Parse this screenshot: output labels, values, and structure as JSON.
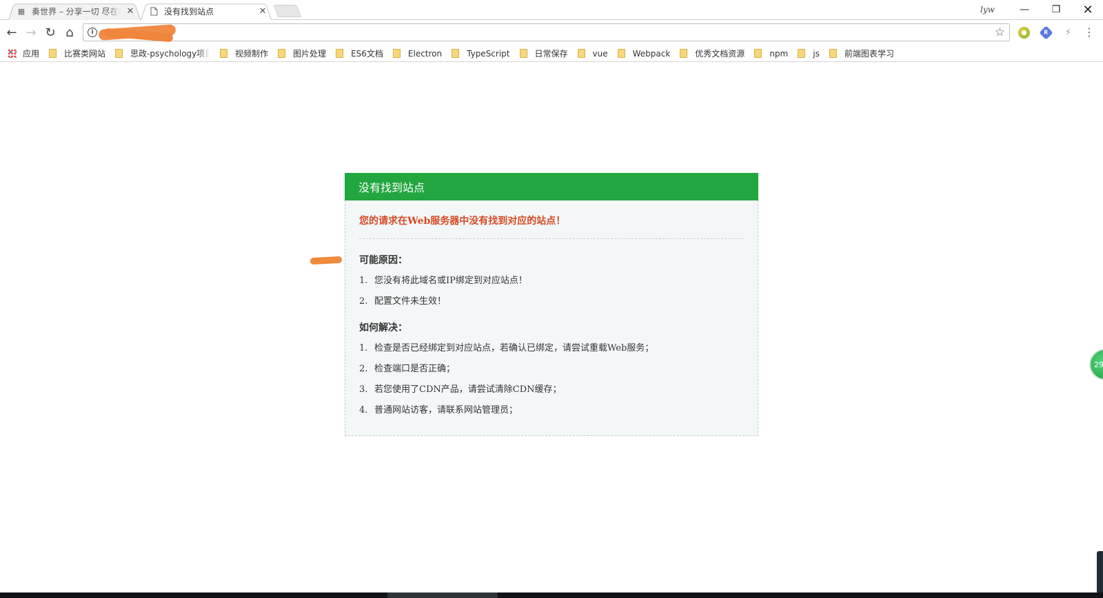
{
  "browser": {
    "tabs": [
      {
        "title": "奏世界 – 分享一切 尽在奏世界",
        "favicon": "site-favicon",
        "active": false
      },
      {
        "title": "没有找到站点",
        "favicon": "page-icon",
        "active": true
      }
    ],
    "profile_name": "lyw",
    "window_controls": {
      "minimize": "—",
      "maximize": "❐",
      "close": "✕"
    },
    "nav": {
      "back": "←",
      "forward": "→",
      "reload": "↻",
      "home": "⌂"
    },
    "address_bar": {
      "url": "",
      "url_redacted": true
    },
    "menu_glyph": "⋮"
  },
  "bookmarks": [
    {
      "label": "应用",
      "type": "apps"
    },
    {
      "label": "比赛类网站",
      "type": "folder"
    },
    {
      "label": "思政-psychology项目",
      "type": "folder"
    },
    {
      "label": "视频制作",
      "type": "folder"
    },
    {
      "label": "图片处理",
      "type": "folder"
    },
    {
      "label": "ES6文档",
      "type": "folder"
    },
    {
      "label": "Electron",
      "type": "folder"
    },
    {
      "label": "TypeScript",
      "type": "folder"
    },
    {
      "label": "日常保存",
      "type": "folder"
    },
    {
      "label": "vue",
      "type": "folder"
    },
    {
      "label": "Webpack",
      "type": "folder"
    },
    {
      "label": "优秀文档资源",
      "type": "folder"
    },
    {
      "label": "npm",
      "type": "folder"
    },
    {
      "label": "js",
      "type": "folder"
    },
    {
      "label": "前端图表学习",
      "type": "folder"
    }
  ],
  "error_card": {
    "header": "没有找到站点",
    "message": "您的请求在Web服务器中没有找到对应的站点！",
    "reasons_title": "可能原因：",
    "reasons": [
      {
        "num": "1.",
        "text": "您没有将此域名或IP绑定到对应站点！"
      },
      {
        "num": "2.",
        "text": "配置文件未生效！"
      }
    ],
    "solutions_title": "如何解决：",
    "solutions": [
      {
        "num": "1.",
        "text": "检查是否已经绑定到对应站点，若确认已绑定，请尝试重载Web服务；"
      },
      {
        "num": "2.",
        "text": "检查端口是否正确；"
      },
      {
        "num": "3.",
        "text": "若您使用了CDN产品，请尝试清除CDN缓存；"
      },
      {
        "num": "4.",
        "text": "普通网站访客，请联系网站管理员；"
      }
    ]
  },
  "side_badge": {
    "text": "29"
  },
  "colors": {
    "header_green": "#22a63f",
    "message_red": "#d64a23",
    "card_bg": "#f3f7f8",
    "annotation_orange": "#f08a3c"
  }
}
